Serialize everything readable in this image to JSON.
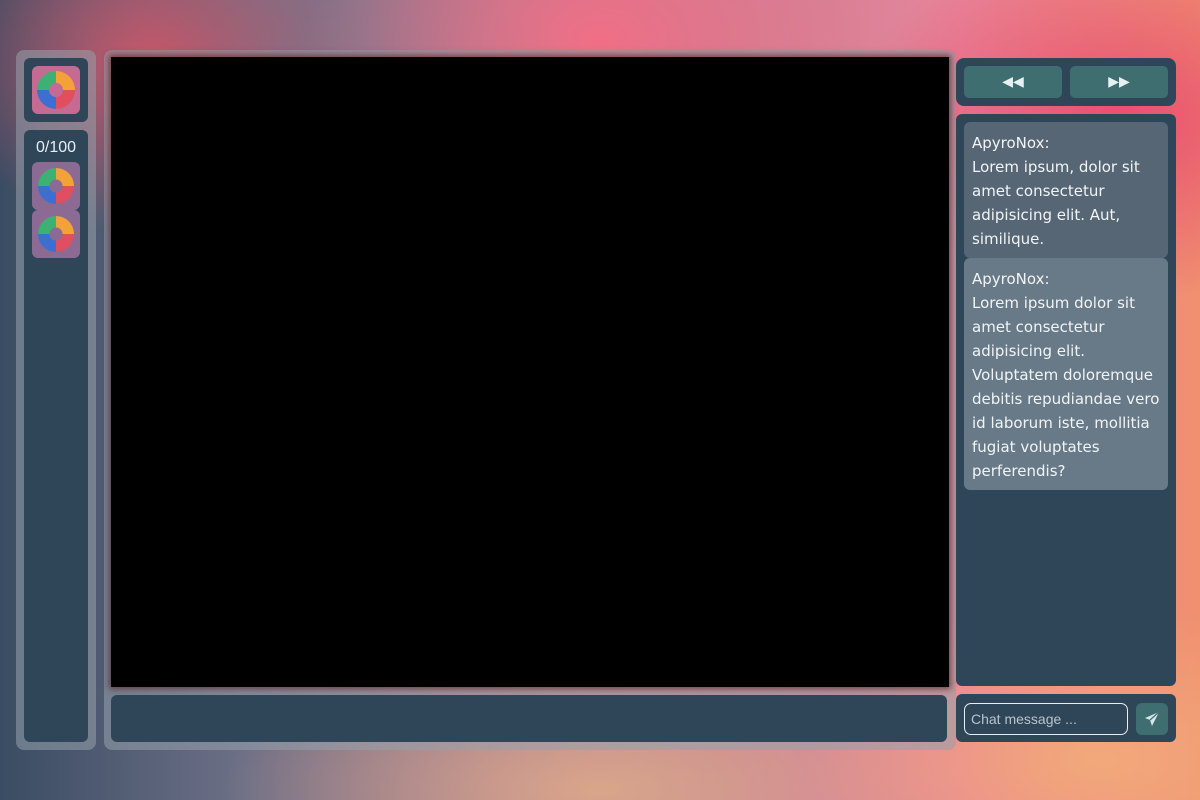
{
  "sidebar": {
    "app_logo_icon": "pinwheel-logo",
    "user_count": "0/100",
    "rooms": [
      {
        "icon": "pinwheel-logo"
      },
      {
        "icon": "pinwheel-logo"
      }
    ]
  },
  "player": {
    "video_state": "blank"
  },
  "navigation": {
    "prev_icon": "rewind-icon",
    "prev_glyph": "◀◀",
    "next_icon": "fast-forward-icon",
    "next_glyph": "▶▶"
  },
  "chat": {
    "messages": [
      {
        "author": "ApyroNox:",
        "text": "Lorem ipsum, dolor sit amet consectetur adipisicing elit. Aut, similique."
      },
      {
        "author": "ApyroNox:",
        "text": "Lorem ipsum dolor sit amet consectetur adipisicing elit. Voluptatem doloremque debitis repudiandae vero id laborum iste, mollitia fugiat voluptates perferendis?"
      }
    ],
    "input_placeholder": "Chat message ...",
    "input_value": "",
    "send_icon": "paper-plane-icon"
  },
  "colors": {
    "panel": "#2f4658",
    "accent": "#3e6e70",
    "message_bg": "#566675"
  }
}
